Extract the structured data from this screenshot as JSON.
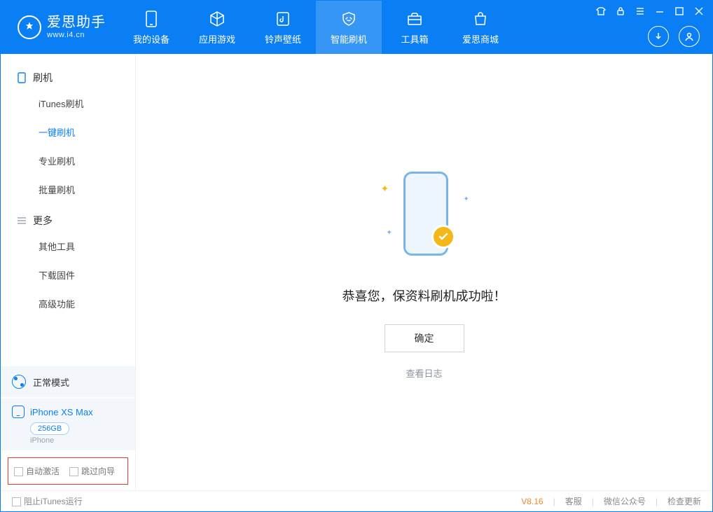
{
  "app": {
    "title": "爱思助手",
    "subtitle": "www.i4.cn"
  },
  "tabs": [
    {
      "label": "我的设备"
    },
    {
      "label": "应用游戏"
    },
    {
      "label": "铃声壁纸"
    },
    {
      "label": "智能刷机"
    },
    {
      "label": "工具箱"
    },
    {
      "label": "爱思商城"
    }
  ],
  "sidebar": {
    "section1": "刷机",
    "items1": [
      "iTunes刷机",
      "一键刷机",
      "专业刷机",
      "批量刷机"
    ],
    "section2": "更多",
    "items2": [
      "其他工具",
      "下载固件",
      "高级功能"
    ]
  },
  "mode": {
    "label": "正常模式"
  },
  "device": {
    "name": "iPhone XS Max",
    "storage": "256GB",
    "type": "iPhone"
  },
  "options": {
    "opt1": "自动激活",
    "opt2": "跳过向导"
  },
  "main": {
    "status": "恭喜您，保资料刷机成功啦！",
    "ok": "确定",
    "viewlog": "查看日志"
  },
  "footer": {
    "block_itunes": "阻止iTunes运行",
    "version": "V8.16",
    "links": [
      "客服",
      "微信公众号",
      "检查更新"
    ]
  }
}
